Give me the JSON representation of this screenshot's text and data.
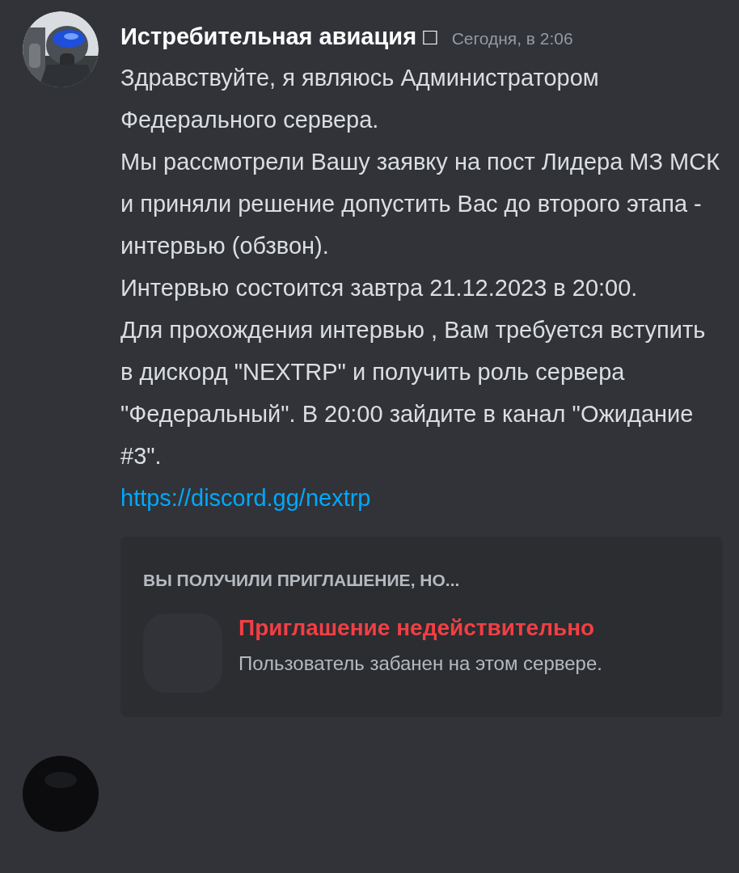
{
  "message": {
    "author": "Истребительная авиация □",
    "timestamp": "Сегодня, в 2:06",
    "paragraphs": [
      "Здравствуйте, я являюсь Администратором Федерального сервера.",
      "Мы рассмотрели Вашу заявку на пост Лидера МЗ МСК и приняли решение допустить Вас до второго этапа - интервью (обзвон).",
      "Интервью состоится завтра 21.12.2023 в 20:00.",
      "Для прохождения интервью , Вам требуется вступить в дискорд \"NEXTRP\" и получить роль сервера \"Федеральный\". В 20:00 зайдите в канал \"Ожидание #3\"."
    ],
    "link": "https://discord.gg/nextrp"
  },
  "invite": {
    "heading": "ВЫ ПОЛУЧИЛИ ПРИГЛАШЕНИЕ, НО...",
    "title": "Приглашение недействительно",
    "description": "Пользователь забанен на этом сервере."
  }
}
